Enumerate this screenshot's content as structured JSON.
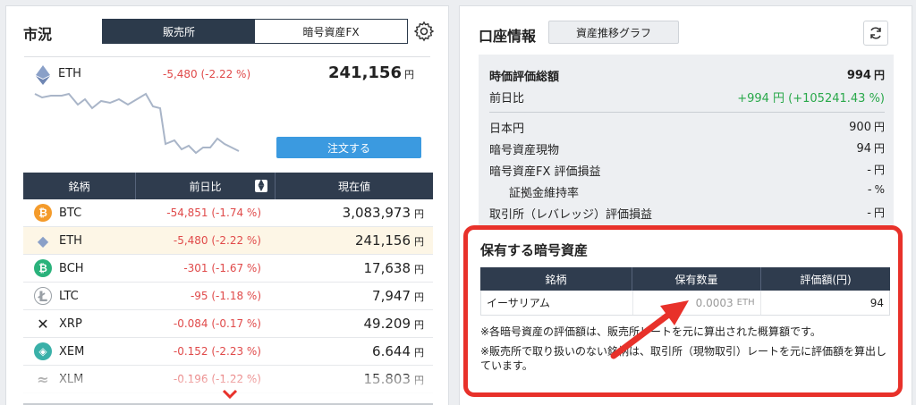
{
  "market": {
    "title": "市況",
    "tabs": [
      "販売所",
      "暗号資産FX"
    ],
    "featured": {
      "symbol": "ETH",
      "change": "-5,480 (-2.22 %)",
      "price": "241,156",
      "yen": "円",
      "order_label": "注文する"
    },
    "table": {
      "headers": [
        "銘柄",
        "前日比",
        "現在値"
      ],
      "rows": [
        {
          "symbol": "BTC",
          "change": "-54,851 (-1.74 %)",
          "price": "3,083,973",
          "yen": "円",
          "icon": "bitcoin-icon",
          "color": "#f49b2b"
        },
        {
          "symbol": "ETH",
          "change": "-5,480 (-2.22 %)",
          "price": "241,156",
          "yen": "円",
          "icon": "ethereum-icon",
          "color": "#8aa0c8"
        },
        {
          "symbol": "BCH",
          "change": "-301 (-1.67 %)",
          "price": "17,638",
          "yen": "円",
          "icon": "bitcoin-cash-icon",
          "color": "#2ab27b"
        },
        {
          "symbol": "LTC",
          "change": "-95 (-1.18 %)",
          "price": "7,947",
          "yen": "円",
          "icon": "litecoin-icon",
          "color": "#9aa0a6"
        },
        {
          "symbol": "XRP",
          "change": "-0.084 (-0.17 %)",
          "price": "49.209",
          "yen": "円",
          "icon": "xrp-icon",
          "color": "#222222"
        },
        {
          "symbol": "XEM",
          "change": "-0.152 (-2.23 %)",
          "price": "6.644",
          "yen": "円",
          "icon": "nem-icon",
          "color": "#39b0a8"
        },
        {
          "symbol": "XLM",
          "change": "-0.196 (-1.22 %)",
          "price": "15.803",
          "yen": "円",
          "icon": "stellar-icon",
          "color": "#777777"
        }
      ]
    }
  },
  "account": {
    "title": "口座情報",
    "history_label": "資産推移グラフ",
    "summary": {
      "total_label": "時価評価総額",
      "total_value": "994",
      "prev_label": "前日比",
      "prev_value": "+994 円 (+105241.43 %)",
      "jpy_label": "日本円",
      "jpy_value": "900",
      "spot_label": "暗号資産現物",
      "spot_value": "94",
      "fx_label": "暗号資産FX 評価損益",
      "fx_value": "-",
      "margin_label": "証拠金維持率",
      "margin_value": "-",
      "margin_unit": "%",
      "exchange_label": "取引所（レバレッジ）評価損益",
      "exchange_value": "-",
      "yen": "円"
    }
  },
  "holdings": {
    "title": "保有する暗号資産",
    "headers": [
      "銘柄",
      "保有数量",
      "評価額(円)"
    ],
    "rows": [
      {
        "name": "イーサリアム",
        "qty": "0.0003",
        "unit": "ETH",
        "value": "94"
      }
    ],
    "note1": "※各暗号資産の評価額は、販売所レートを元に算出された概算額です。",
    "note2": "※販売所で取り扱いのない銘柄は、取引所（現物取引）レートを元に評価額を算出しています。"
  },
  "colors": {
    "accent": "#3b9ae0",
    "negative": "#e04a4a",
    "positive": "#29a84a",
    "highlight": "#e8312a"
  }
}
